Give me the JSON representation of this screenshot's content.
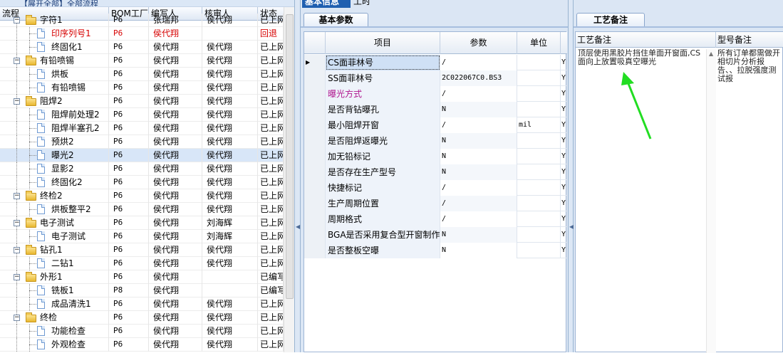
{
  "left_panel": {
    "top_button": "【展开全部】全部流程",
    "columns": [
      "流程",
      "BOM工厂",
      "编写人",
      "核审人",
      "状态"
    ],
    "rows": [
      {
        "name": "字符1",
        "level": 1,
        "kind": "folder",
        "bom": "P6",
        "writer": "张瑞邦",
        "reviewer": "侯代翔",
        "status": "已上网",
        "red": false
      },
      {
        "name": "印序列号1",
        "level": 2,
        "kind": "doc",
        "bom": "P6",
        "writer": "侯代翔",
        "reviewer": "",
        "status": "回退",
        "red": true
      },
      {
        "name": "终固化1",
        "level": 2,
        "kind": "doc",
        "bom": "P6",
        "writer": "侯代翔",
        "reviewer": "侯代翔",
        "status": "已上网",
        "red": false
      },
      {
        "name": "有铅喷锡",
        "level": 1,
        "kind": "folder",
        "bom": "P6",
        "writer": "侯代翔",
        "reviewer": "侯代翔",
        "status": "已上网",
        "red": false
      },
      {
        "name": "烘板",
        "level": 2,
        "kind": "doc",
        "bom": "P6",
        "writer": "侯代翔",
        "reviewer": "侯代翔",
        "status": "已上网",
        "red": false
      },
      {
        "name": "有铅喷锡",
        "level": 2,
        "kind": "doc",
        "bom": "P6",
        "writer": "侯代翔",
        "reviewer": "侯代翔",
        "status": "已上网",
        "red": false
      },
      {
        "name": "阻焊2",
        "level": 1,
        "kind": "folder",
        "bom": "P6",
        "writer": "侯代翔",
        "reviewer": "侯代翔",
        "status": "已上网",
        "red": false
      },
      {
        "name": "阻焊前处理2",
        "level": 2,
        "kind": "doc",
        "bom": "P6",
        "writer": "侯代翔",
        "reviewer": "侯代翔",
        "status": "已上网",
        "red": false
      },
      {
        "name": "阻焊半塞孔2",
        "level": 2,
        "kind": "doc",
        "bom": "P6",
        "writer": "侯代翔",
        "reviewer": "侯代翔",
        "status": "已上网",
        "red": false
      },
      {
        "name": "预烘2",
        "level": 2,
        "kind": "doc",
        "bom": "P6",
        "writer": "侯代翔",
        "reviewer": "侯代翔",
        "status": "已上网",
        "red": false
      },
      {
        "name": "曝光2",
        "level": 2,
        "kind": "doc",
        "bom": "P6",
        "writer": "侯代翔",
        "reviewer": "侯代翔",
        "status": "已上网",
        "red": false,
        "selected": true
      },
      {
        "name": "显影2",
        "level": 2,
        "kind": "doc",
        "bom": "P6",
        "writer": "侯代翔",
        "reviewer": "侯代翔",
        "status": "已上网",
        "red": false
      },
      {
        "name": "终固化2",
        "level": 2,
        "kind": "doc",
        "bom": "P6",
        "writer": "侯代翔",
        "reviewer": "侯代翔",
        "status": "已上网",
        "red": false
      },
      {
        "name": "终检2",
        "level": 1,
        "kind": "folder",
        "bom": "P6",
        "writer": "侯代翔",
        "reviewer": "侯代翔",
        "status": "已上网",
        "red": false
      },
      {
        "name": "烘板整平2",
        "level": 2,
        "kind": "doc",
        "bom": "P6",
        "writer": "侯代翔",
        "reviewer": "侯代翔",
        "status": "已上网",
        "red": false
      },
      {
        "name": "电子测试",
        "level": 1,
        "kind": "folder",
        "bom": "P6",
        "writer": "侯代翔",
        "reviewer": "刘海辉",
        "status": "已上网",
        "red": false
      },
      {
        "name": "电子测试",
        "level": 2,
        "kind": "doc",
        "bom": "P6",
        "writer": "侯代翔",
        "reviewer": "刘海辉",
        "status": "已上网",
        "red": false
      },
      {
        "name": "钻孔1",
        "level": 1,
        "kind": "folder",
        "bom": "P6",
        "writer": "侯代翔",
        "reviewer": "侯代翔",
        "status": "已上网",
        "red": false
      },
      {
        "name": "二钻1",
        "level": 2,
        "kind": "doc",
        "bom": "P6",
        "writer": "侯代翔",
        "reviewer": "侯代翔",
        "status": "已上网",
        "red": false
      },
      {
        "name": "外形1",
        "level": 1,
        "kind": "folder",
        "bom": "P6",
        "writer": "侯代翔",
        "reviewer": "",
        "status": "已编写",
        "red": false
      },
      {
        "name": "铣板1",
        "level": 2,
        "kind": "doc",
        "bom": "P8",
        "writer": "侯代翔",
        "reviewer": "",
        "status": "已编写",
        "red": false
      },
      {
        "name": "成品清洗1",
        "level": 2,
        "kind": "doc",
        "bom": "P6",
        "writer": "侯代翔",
        "reviewer": "侯代翔",
        "status": "已上网",
        "red": false
      },
      {
        "name": "终检",
        "level": 1,
        "kind": "folder",
        "bom": "P6",
        "writer": "侯代翔",
        "reviewer": "侯代翔",
        "status": "已上网",
        "red": false
      },
      {
        "name": "功能检查",
        "level": 2,
        "kind": "doc",
        "bom": "P6",
        "writer": "侯代翔",
        "reviewer": "侯代翔",
        "status": "已上网",
        "red": false
      },
      {
        "name": "外观检查",
        "level": 2,
        "kind": "doc",
        "bom": "P6",
        "writer": "侯代翔",
        "reviewer": "侯代翔",
        "status": "已上网",
        "red": false
      }
    ]
  },
  "middle_panel": {
    "tabs": [
      "基本信息",
      "工时"
    ],
    "subtab": "基本参数",
    "columns": [
      "项目",
      "参数",
      "单位"
    ],
    "rows": [
      {
        "item": "CS面菲林号",
        "param": "/",
        "unit": "",
        "flag": "Y",
        "pink": false,
        "current": true
      },
      {
        "item": "SS面菲林号",
        "param": "2C022067C0.BS3",
        "unit": "",
        "flag": "Y",
        "pink": false
      },
      {
        "item": "曝光方式",
        "param": "/",
        "unit": "",
        "flag": "Y",
        "pink": true
      },
      {
        "item": "是否背钻曝孔",
        "param": "N",
        "unit": "",
        "flag": "Y",
        "pink": false
      },
      {
        "item": "最小阻焊开窗",
        "param": "/",
        "unit": "mil",
        "flag": "Y",
        "pink": false
      },
      {
        "item": "是否阻焊返曝光",
        "param": "N",
        "unit": "",
        "flag": "Y",
        "pink": false
      },
      {
        "item": "加无铅标记",
        "param": "N",
        "unit": "",
        "flag": "Y",
        "pink": false
      },
      {
        "item": "是否存在生产型号",
        "param": "N",
        "unit": "",
        "flag": "Y",
        "pink": false
      },
      {
        "item": "快捷标记",
        "param": "/",
        "unit": "",
        "flag": "Y",
        "pink": false
      },
      {
        "item": "生产周期位置",
        "param": "/",
        "unit": "",
        "flag": "Y",
        "pink": false
      },
      {
        "item": "周期格式",
        "param": "/",
        "unit": "",
        "flag": "Y",
        "pink": false
      },
      {
        "item": "BGA是否采用复合型开窗制作",
        "param": "N",
        "unit": "",
        "flag": "Y",
        "pink": false
      },
      {
        "item": "是否整板空曝",
        "param": "N",
        "unit": "",
        "flag": "Y",
        "pink": false
      }
    ]
  },
  "right_panel": {
    "tab": "工艺备注",
    "columns": [
      "工艺备注",
      "型号备注"
    ],
    "process_note": "顶层使用黑胶片挡住单面开窗面,CS面向上放置吸真空曝光",
    "model_note": "所有订单都需做开相切片分析报告、、拉脱强度测试报"
  },
  "colors": {
    "selected_tab": "#1f5fb0",
    "rejected_text": "#d60000",
    "pink_label": "#b0178f",
    "annotation_arrow": "#22dd22"
  }
}
